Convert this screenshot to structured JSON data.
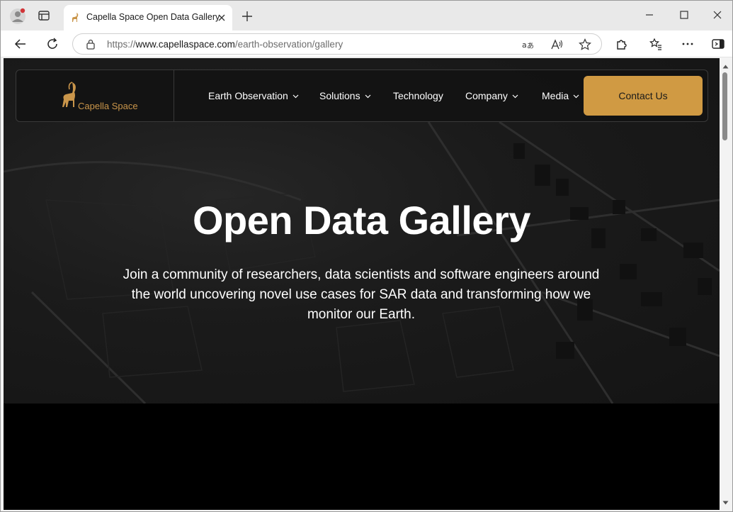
{
  "browser": {
    "tab_title": "Capella Space Open Data Gallery",
    "url_prefix": "https://",
    "url_host": "www.capellaspace.com",
    "url_path": "/earth-observation/gallery"
  },
  "site": {
    "logo_text": "Capella Space",
    "nav": [
      {
        "label": "Earth Observation",
        "has_dropdown": true
      },
      {
        "label": "Solutions",
        "has_dropdown": true
      },
      {
        "label": "Technology",
        "has_dropdown": false
      },
      {
        "label": "Company",
        "has_dropdown": true
      },
      {
        "label": "Media",
        "has_dropdown": true
      }
    ],
    "contact_label": "Contact Us",
    "hero_title": "Open Data Gallery",
    "hero_subtitle": "Join a community of researchers, data scientists and software engineers around the world uncovering novel use cases for SAR data and transforming how we monitor our Earth."
  },
  "colors": {
    "accent": "#d09a43",
    "logo": "#c9954a",
    "page_bg": "#000000",
    "hero_bg": "#1b1b1b"
  }
}
